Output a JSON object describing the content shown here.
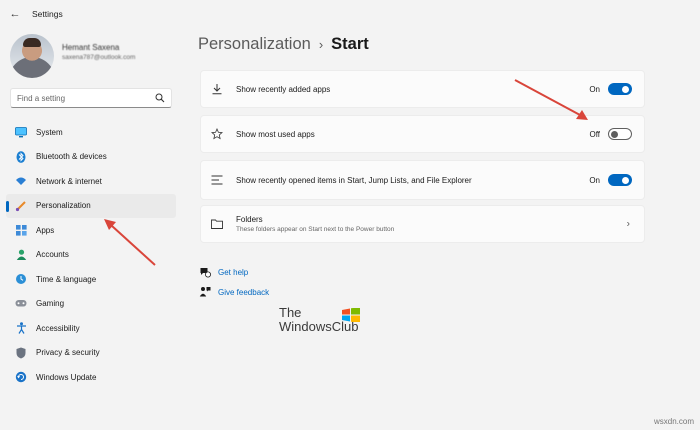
{
  "window": {
    "title": "Settings"
  },
  "profile": {
    "name": "Hemant Saxena",
    "email": "saxena787@outlook.com"
  },
  "search": {
    "placeholder": "Find a setting"
  },
  "sidebar": {
    "items": [
      {
        "label": "System",
        "icon": "monitor-icon",
        "active": false
      },
      {
        "label": "Bluetooth & devices",
        "icon": "bluetooth-icon",
        "active": false
      },
      {
        "label": "Network & internet",
        "icon": "wifi-icon",
        "active": false
      },
      {
        "label": "Personalization",
        "icon": "brush-icon",
        "active": true
      },
      {
        "label": "Apps",
        "icon": "apps-icon",
        "active": false
      },
      {
        "label": "Accounts",
        "icon": "person-icon",
        "active": false
      },
      {
        "label": "Time & language",
        "icon": "globe-clock-icon",
        "active": false
      },
      {
        "label": "Gaming",
        "icon": "gamepad-icon",
        "active": false
      },
      {
        "label": "Accessibility",
        "icon": "accessibility-icon",
        "active": false
      },
      {
        "label": "Privacy & security",
        "icon": "shield-icon",
        "active": false
      },
      {
        "label": "Windows Update",
        "icon": "update-icon",
        "active": false
      }
    ]
  },
  "header": {
    "parent": "Personalization",
    "separator": "›",
    "current": "Start"
  },
  "settings": [
    {
      "label": "Show recently added apps",
      "icon": "download-icon",
      "state": "On"
    },
    {
      "label": "Show most used apps",
      "icon": "star-icon",
      "state": "Off"
    },
    {
      "label": "Show recently opened items in Start, Jump Lists, and File Explorer",
      "icon": "list-icon",
      "state": "On"
    }
  ],
  "folders": {
    "label": "Folders",
    "description": "These folders appear on Start next to the Power button"
  },
  "links": {
    "help": "Get help",
    "feedback": "Give feedback"
  },
  "logo": {
    "line1": "The",
    "line2": "WindowsClub"
  },
  "watermark": "wsxdn.com",
  "colors": {
    "accent": "#0067c0",
    "background": "#f3f3f3",
    "card": "#fbfbfb",
    "annotation_arrow": "#d9453a"
  }
}
